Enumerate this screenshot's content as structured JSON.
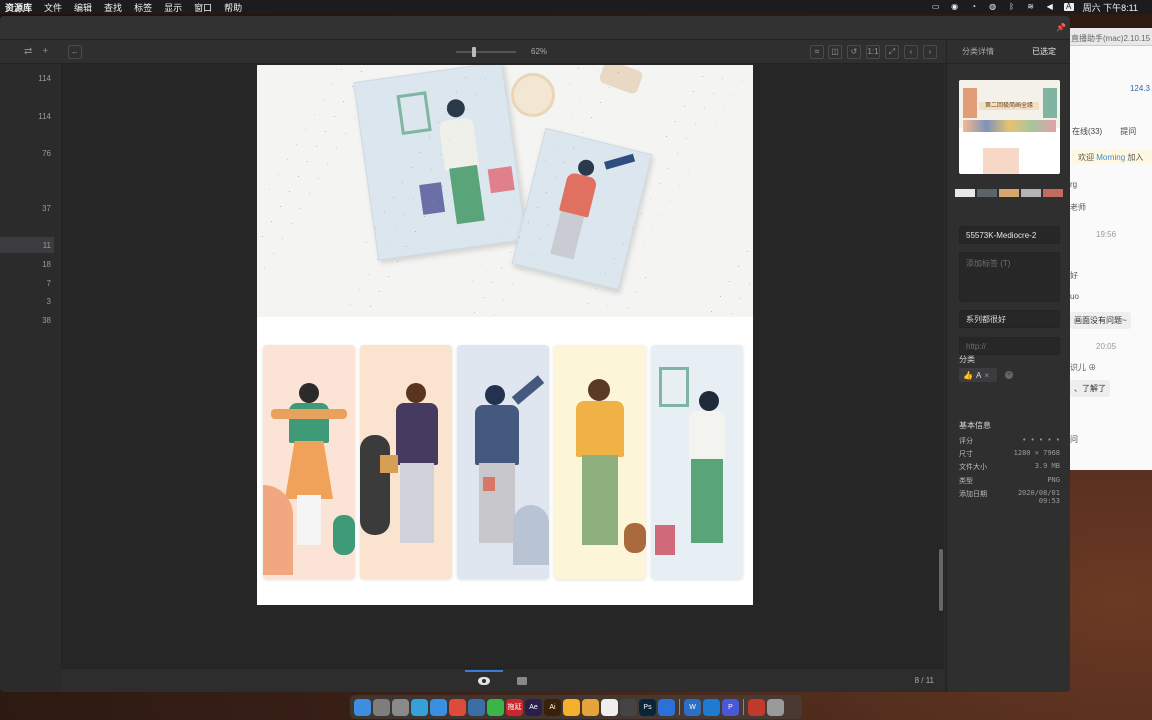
{
  "menubar": {
    "app_name": "资源库",
    "menus": [
      "文件",
      "编辑",
      "查找",
      "标签",
      "显示",
      "窗口",
      "帮助"
    ],
    "clock": "周六 下午8:11",
    "input_indicator": "A"
  },
  "background_app": {
    "title": "直播助手(mac)2.10.15",
    "signal_value": "124.3",
    "tab_online": "在线(33)",
    "tab_question": "提问",
    "join_prefix": "欢迎",
    "join_user": "Morning",
    "join_suffix": "加入",
    "lines": [
      "rg",
      "老师",
      "好",
      "uo",
      "识儿 ⊕",
      "问"
    ],
    "times": [
      "19:56",
      "20:05"
    ],
    "bubbles": [
      "画面没有问题~",
      "、了解了"
    ]
  },
  "toolbar": {
    "zoom_label": "62%",
    "buttons": [
      "crop-icon",
      "split-icon",
      "rotate-icon",
      "actual-size-icon",
      "fit-icon",
      "prev-icon",
      "next-icon"
    ]
  },
  "left_column": {
    "counts": [
      "114",
      "114",
      "76",
      "37",
      "11",
      "18",
      "7",
      "3",
      "38"
    ],
    "active_index": 4
  },
  "inspector": {
    "tab_category_details": "分类详情",
    "tab_selected": "已选定",
    "swatches": [
      "#e8e8e8",
      "#5b6466",
      "#d6a66a",
      "#b3b4b3",
      "#c36b5e"
    ],
    "filename": "55573K-Mediocre-2",
    "tags_placeholder": "添加标签 (T)",
    "note": "系列都很好",
    "url_placeholder": "http://",
    "category_label": "分类",
    "category_chip": "A",
    "chip_close": "×",
    "basic_info_label": "基本信息",
    "info": [
      {
        "key": "评分",
        "value": "• • • • •"
      },
      {
        "key": "尺寸",
        "value": "1280 × 7968"
      },
      {
        "key": "文件大小",
        "value": "3.9 MB"
      },
      {
        "key": "类型",
        "value": "PNG"
      },
      {
        "key": "添加日期",
        "value": "2020/08/01 09:53"
      }
    ]
  },
  "thumbnail": {
    "caption": "第二回极简画全缘"
  },
  "bottom": {
    "page_counter": "8 / 11"
  },
  "dock": {
    "apps": [
      {
        "name": "finder-icon",
        "color": "#3d8de0",
        "label": ""
      },
      {
        "name": "launchpad-icon",
        "color": "#7d7d7d",
        "label": ""
      },
      {
        "name": "preferences-icon",
        "color": "#8a8a8a",
        "label": ""
      },
      {
        "name": "telegram-icon",
        "color": "#34a2d8",
        "label": ""
      },
      {
        "name": "safari-icon",
        "color": "#3b8fe0",
        "label": ""
      },
      {
        "name": "chrome-icon",
        "color": "#dd4c3b",
        "label": ""
      },
      {
        "name": "search-app-icon",
        "color": "#3a6ea5",
        "label": ""
      },
      {
        "name": "wechat-icon",
        "color": "#3bb54a",
        "label": ""
      },
      {
        "name": "red-app-icon",
        "color": "#c8272e",
        "label": "拖延"
      },
      {
        "name": "after-effects-icon",
        "color": "#2a1f4a",
        "label": "Ae"
      },
      {
        "name": "illustrator-icon",
        "color": "#3a2006",
        "label": "Ai"
      },
      {
        "name": "sketch-icon",
        "color": "#f5b02b",
        "label": ""
      },
      {
        "name": "cloud-icon",
        "color": "#e6a33a",
        "label": ""
      },
      {
        "name": "ball-icon",
        "color": "#eeeeee",
        "label": ""
      },
      {
        "name": "chatgpt-icon",
        "color": "#444",
        "label": ""
      },
      {
        "name": "photoshop-icon",
        "color": "#0b2438",
        "label": "Ps"
      },
      {
        "name": "browser-icon",
        "color": "#2a72d8",
        "label": ""
      },
      {
        "name": "word-icon",
        "color": "#2d6ec7",
        "label": "W"
      },
      {
        "name": "keynote-icon",
        "color": "#1e7bd1",
        "label": ""
      },
      {
        "name": "pocket-icon",
        "color": "#4a58d8",
        "label": "P"
      },
      {
        "name": "downloads-icon",
        "color": "#c0392b",
        "label": ""
      },
      {
        "name": "trash-icon",
        "color": "#9a9a9a",
        "label": ""
      }
    ]
  }
}
